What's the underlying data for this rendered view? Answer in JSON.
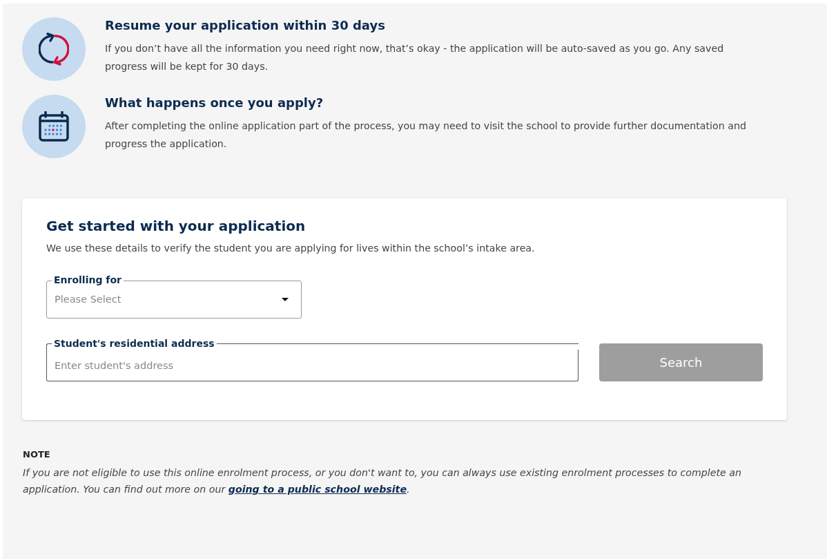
{
  "info_items": [
    {
      "kind": "refresh",
      "title": "Resume your application within 30 days",
      "body": "If you don’t have all the information you need right now, that’s okay - the application will be auto-saved as you go. Any saved progress will be kept for 30 days."
    },
    {
      "kind": "calendar",
      "title": "What happens once you apply?",
      "body": "After completing the online application part of the process, you may need to visit the school to provide further documentation and progress the application."
    }
  ],
  "form_card": {
    "title": "Get started with your application",
    "description": "We use these details to verify the student you are applying for lives within the school’s intake area.",
    "enrolling_for": {
      "label": "Enrolling for",
      "placeholder": "Please Select"
    },
    "address": {
      "label": "Student's residential address",
      "placeholder": "Enter student's address"
    },
    "search_button": {
      "label": "Search",
      "disabled": true
    }
  },
  "note": {
    "heading": "NOTE",
    "text_before": "If you are not eligible to use this online enrolment process, or you don't want to, you can always use existing enrolment processes to complete an application. You can find out more on our ",
    "link": "going to a public school website",
    "text_after": "."
  }
}
